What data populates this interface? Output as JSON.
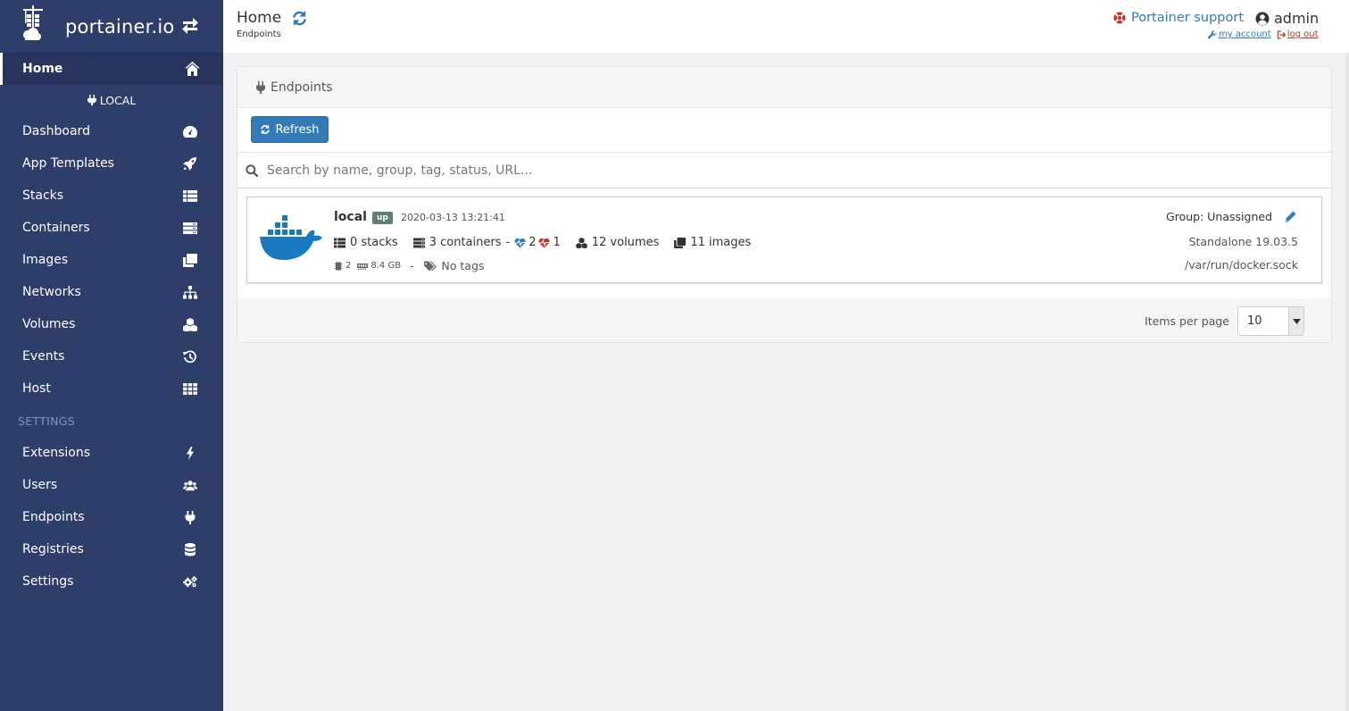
{
  "brand": {
    "name": "portainer.io"
  },
  "sidebar": {
    "home_label": "Home",
    "environment": "LOCAL",
    "items": [
      {
        "label": "Dashboard",
        "icon": "tachometer-icon"
      },
      {
        "label": "App Templates",
        "icon": "rocket-icon"
      },
      {
        "label": "Stacks",
        "icon": "th-list-icon"
      },
      {
        "label": "Containers",
        "icon": "server-icon"
      },
      {
        "label": "Images",
        "icon": "clone-icon"
      },
      {
        "label": "Networks",
        "icon": "sitemap-icon"
      },
      {
        "label": "Volumes",
        "icon": "cubes-icon"
      },
      {
        "label": "Events",
        "icon": "history-icon"
      },
      {
        "label": "Host",
        "icon": "th-icon"
      }
    ],
    "settings_header": "SETTINGS",
    "settings_items": [
      {
        "label": "Extensions",
        "icon": "bolt-icon"
      },
      {
        "label": "Users",
        "icon": "users-icon"
      },
      {
        "label": "Endpoints",
        "icon": "plug-icon"
      },
      {
        "label": "Registries",
        "icon": "database-icon"
      },
      {
        "label": "Settings",
        "icon": "cogs-icon"
      }
    ]
  },
  "header": {
    "title": "Home",
    "breadcrumb": "Endpoints",
    "support_label": "Portainer support",
    "username": "admin",
    "my_account": "my account",
    "log_out": "log out"
  },
  "widget": {
    "title": "Endpoints",
    "refresh_label": "Refresh",
    "search_placeholder": "Search by name, group, tag, status, URL...",
    "endpoint": {
      "name": "local",
      "status": "up",
      "timestamp": "2020-03-13 13:21:41",
      "stacks": "0 stacks",
      "containers": "3 containers",
      "dash": "-",
      "healthy": "2",
      "unhealthy": "1",
      "volumes": "12 volumes",
      "images": "11 images",
      "cpu": "2",
      "memory": "8.4 GB",
      "meta_dash": "-",
      "tags": "No tags",
      "group": "Group: Unassigned",
      "version": "Standalone 19.03.5",
      "url": "/var/run/docker.sock"
    },
    "items_per_page_label": "Items per page",
    "items_per_page_value": "10"
  },
  "colors": {
    "sidebar_bg": "#2e3e6a",
    "accent": "#337ab7",
    "status_up": "#5f7f70",
    "logout": "#c9302c"
  }
}
